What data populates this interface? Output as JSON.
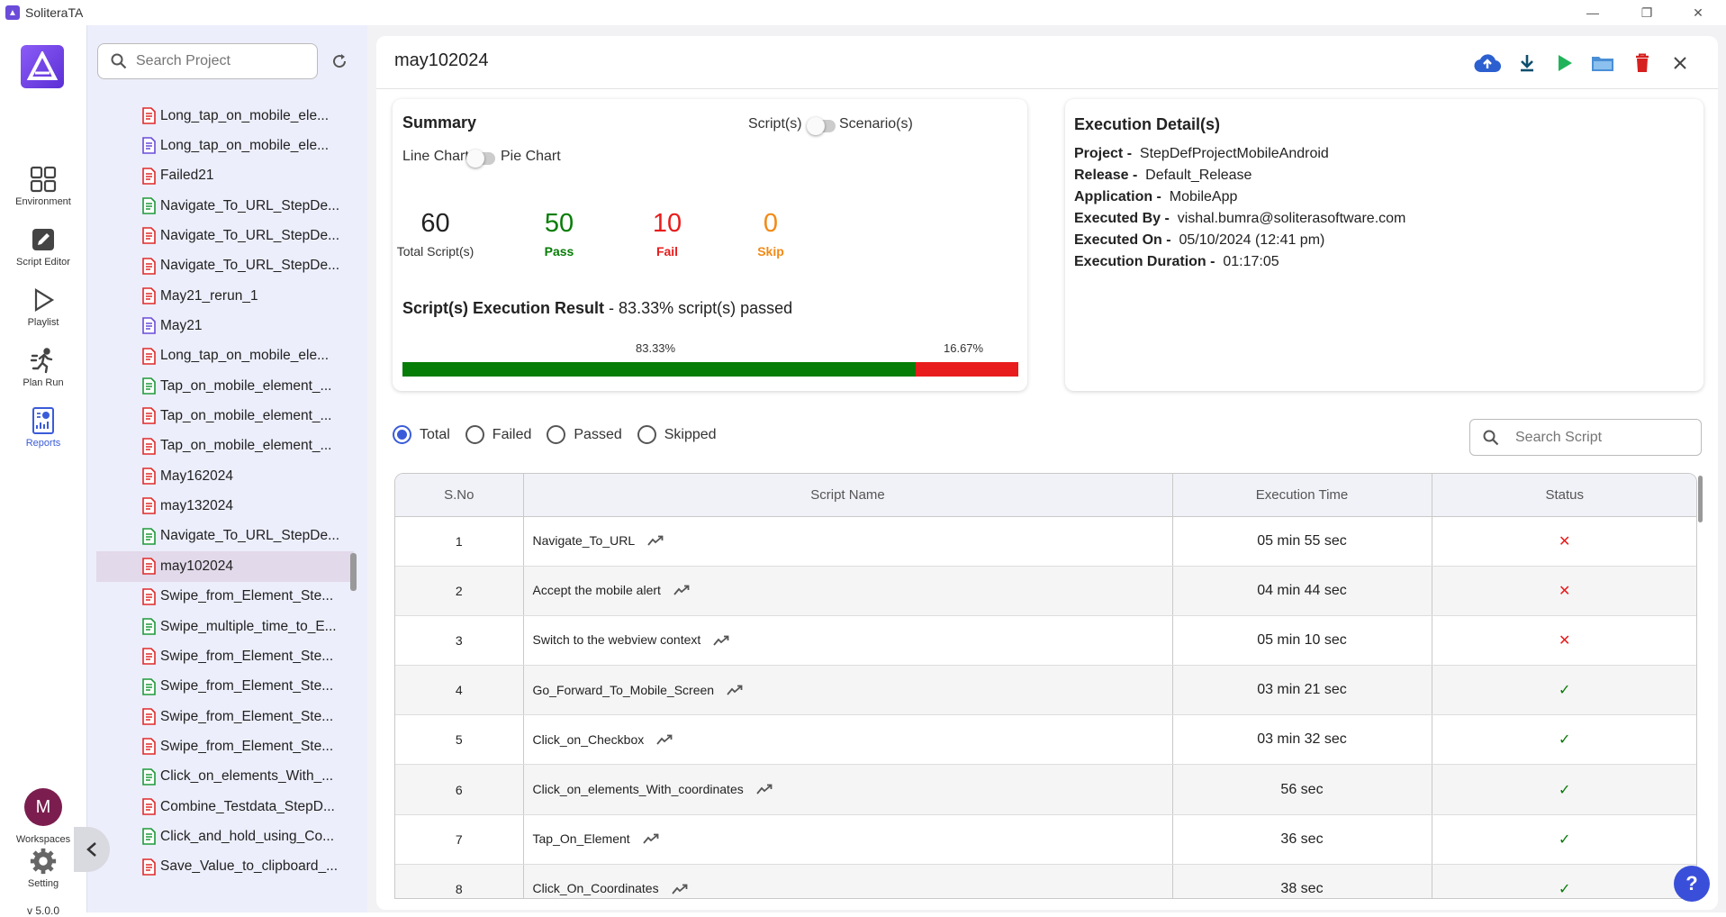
{
  "app": {
    "title": "SoliteraTA",
    "version": "v 5.0.0"
  },
  "rail": {
    "items": [
      {
        "label": "Environment",
        "icon": "grid-icon"
      },
      {
        "label": "Script Editor",
        "icon": "edit-icon"
      },
      {
        "label": "Playlist",
        "icon": "play-outline-icon"
      },
      {
        "label": "Plan Run",
        "icon": "run-icon"
      },
      {
        "label": "Reports",
        "icon": "report-icon"
      }
    ],
    "avatar_letter": "M",
    "workspaces_label": "Workspaces",
    "setting_label": "Setting"
  },
  "project_panel": {
    "search_placeholder": "Search Project",
    "items": [
      {
        "label": "Long_tap_on_mobile_ele...",
        "doc": "red"
      },
      {
        "label": "Long_tap_on_mobile_ele...",
        "doc": "purple"
      },
      {
        "label": "Failed21",
        "doc": "red"
      },
      {
        "label": "Navigate_To_URL_StepDe...",
        "doc": "green"
      },
      {
        "label": "Navigate_To_URL_StepDe...",
        "doc": "red"
      },
      {
        "label": "Navigate_To_URL_StepDe...",
        "doc": "red"
      },
      {
        "label": "May21_rerun_1",
        "doc": "red"
      },
      {
        "label": "May21",
        "doc": "purple"
      },
      {
        "label": "Long_tap_on_mobile_ele...",
        "doc": "red"
      },
      {
        "label": "Tap_on_mobile_element_...",
        "doc": "green"
      },
      {
        "label": "Tap_on_mobile_element_...",
        "doc": "red"
      },
      {
        "label": "Tap_on_mobile_element_...",
        "doc": "red"
      },
      {
        "label": "May162024",
        "doc": "red"
      },
      {
        "label": "may132024",
        "doc": "red"
      },
      {
        "label": "Navigate_To_URL_StepDe...",
        "doc": "green"
      },
      {
        "label": "may102024",
        "doc": "red",
        "active": true
      },
      {
        "label": "Swipe_from_Element_Ste...",
        "doc": "red"
      },
      {
        "label": "Swipe_multiple_time_to_E...",
        "doc": "green"
      },
      {
        "label": "Swipe_from_Element_Ste...",
        "doc": "red"
      },
      {
        "label": "Swipe_from_Element_Ste...",
        "doc": "green"
      },
      {
        "label": "Swipe_from_Element_Ste...",
        "doc": "red"
      },
      {
        "label": "Swipe_from_Element_Ste...",
        "doc": "red"
      },
      {
        "label": "Click_on_elements_With_...",
        "doc": "green"
      },
      {
        "label": "Combine_Testdata_StepD...",
        "doc": "red"
      },
      {
        "label": "Click_and_hold_using_Co...",
        "doc": "green"
      },
      {
        "label": "Save_Value_to_clipboard_...",
        "doc": "red"
      }
    ]
  },
  "report": {
    "title": "may102024",
    "summary": {
      "title": "Summary",
      "toggle_left": "Script(s)",
      "toggle_right": "Scenario(s)",
      "chart_left": "Line Chart",
      "chart_right": "Pie Chart",
      "total": {
        "value": "60",
        "label": "Total Script(s)"
      },
      "pass": {
        "value": "50",
        "label": "Pass"
      },
      "fail": {
        "value": "10",
        "label": "Fail"
      },
      "skip": {
        "value": "0",
        "label": "Skip"
      },
      "exec_title": "Script(s) Execution Result",
      "exec_suffix": " - 83.33% script(s) passed",
      "pass_pct_label": "83.33%",
      "fail_pct_label": "16.67%",
      "pass_fraction": 0.8333,
      "colors": {
        "pass": "#067d06",
        "fail": "#e81c1c",
        "skip": "#f28a16"
      }
    },
    "details": {
      "title": "Execution Detail(s)",
      "rows": [
        {
          "key": "Project -",
          "value": "StepDefProjectMobileAndroid"
        },
        {
          "key": "Release -",
          "value": "Default_Release"
        },
        {
          "key": "Application -",
          "value": "MobileApp"
        },
        {
          "key": "Executed By -",
          "value": "vishal.bumra@soliterasoftware.com"
        },
        {
          "key": "Executed On -",
          "value": "05/10/2024 (12:41 pm)"
        },
        {
          "key": "Execution Duration -",
          "value": "01:17:05"
        }
      ]
    },
    "filters": [
      {
        "label": "Total",
        "checked": true
      },
      {
        "label": "Failed",
        "checked": false
      },
      {
        "label": "Passed",
        "checked": false
      },
      {
        "label": "Skipped",
        "checked": false
      }
    ],
    "search_script_placeholder": "Search Script",
    "table": {
      "headers": [
        "S.No",
        "Script Name",
        "Execution Time",
        "Status"
      ],
      "rows": [
        {
          "no": "1",
          "name": "Navigate_To_URL",
          "time": "05 min 55 sec",
          "status": "fail"
        },
        {
          "no": "2",
          "name": "Accept the mobile alert",
          "time": "04 min 44 sec",
          "status": "fail"
        },
        {
          "no": "3",
          "name": "Switch to the webview context",
          "time": "05 min 10 sec",
          "status": "fail"
        },
        {
          "no": "4",
          "name": "Go_Forward_To_Mobile_Screen",
          "time": "03 min 21 sec",
          "status": "pass"
        },
        {
          "no": "5",
          "name": "Click_on_Checkbox",
          "time": "03 min 32 sec",
          "status": "pass"
        },
        {
          "no": "6",
          "name": "Click_on_elements_With_coordinates",
          "time": "56 sec",
          "status": "pass"
        },
        {
          "no": "7",
          "name": "Tap_On_Element",
          "time": "36 sec",
          "status": "pass"
        },
        {
          "no": "8",
          "name": "Click_On_Coordinates",
          "time": "38 sec",
          "status": "pass"
        }
      ],
      "status_symbols": {
        "fail": "✕",
        "pass": "✓"
      }
    }
  }
}
